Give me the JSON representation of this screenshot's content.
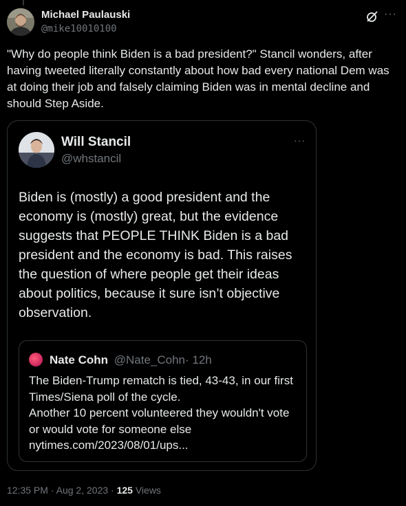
{
  "tweet": {
    "author_name": "Michael Paulauski",
    "author_handle": "@mike10010100",
    "text": "\"Why do people think Biden is a bad president?\" Stancil wonders, after having tweeted literally constantly about how bad every national Dem was at doing their job and falsely claiming Biden was in mental decline and should Step Aside.",
    "time": "12:35 PM",
    "date": "Aug 2, 2023",
    "separator": "·",
    "views_count": "125",
    "views_label": "Views",
    "more_icon": "···"
  },
  "quote": {
    "author_name": "Will Stancil",
    "author_handle": "@whstancil",
    "text": "Biden is (mostly) a good president and the economy is (mostly) great, but the evidence suggests that PEOPLE THINK Biden is a bad president and the economy is bad. This raises the question of where people get their ideas about politics, because it sure isn’t objective observation.",
    "more_icon": "···"
  },
  "inner_quote": {
    "author_name": "Nate Cohn",
    "author_handle": "@Nate_Cohn",
    "time": "· 12h",
    "line1": "The Biden-Trump rematch is tied, 43-43, in our first Times/Siena poll of the cycle.",
    "line2": "Another 10 percent volunteered they wouldn't vote or would vote for someone else",
    "line3": "nytimes.com/2023/08/01/ups..."
  },
  "colors": {
    "background": "#000000",
    "text": "#e7e9ea",
    "secondary_text": "#71767b",
    "border": "#2f3336"
  }
}
